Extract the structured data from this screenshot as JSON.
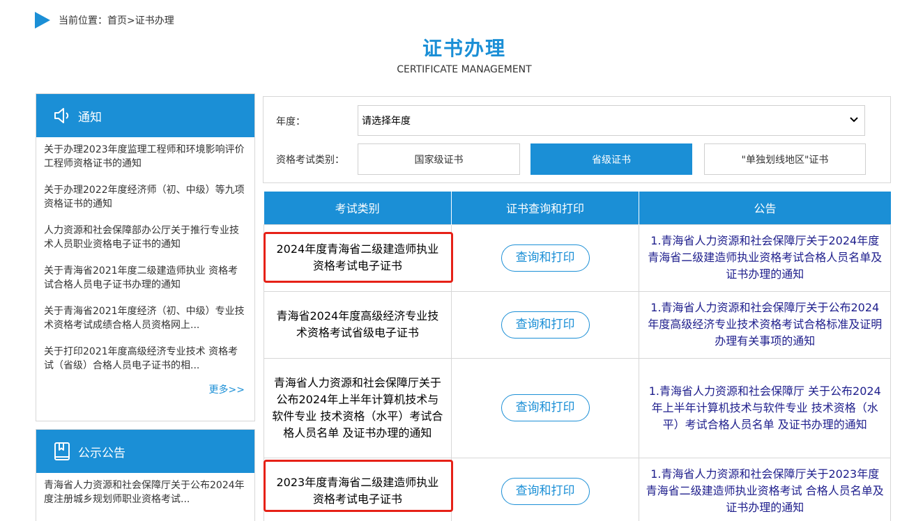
{
  "breadcrumb": {
    "prefix": "当前位置：",
    "home": "首页",
    "sep": ">",
    "current": "证书办理"
  },
  "header": {
    "title": "证书办理",
    "subtitle": "CERTIFICATE MANAGEMENT"
  },
  "sidebar": {
    "notice": {
      "title": "通知",
      "icon": "speaker-icon",
      "items": [
        "关于办理2023年度监理工程师和环境影响评价工程师资格证书的通知",
        "关于办理2022年度经济师（初、中级）等九项资格证书的通知",
        "人力资源和社会保障部办公厅关于推行专业技术人员职业资格电子证书的通知",
        "关于青海省2021年度二级建造师执业 资格考试合格人员电子证书办理的通知",
        "关于青海省2021年度经济（初、中级）专业技术资格考试成绩合格人员资格网上...",
        "关于打印2021年度高级经济专业技术 资格考试（省级）合格人员电子证书的相..."
      ],
      "more": "更多>>"
    },
    "announce": {
      "title": "公示公告",
      "icon": "bookmark-book-icon",
      "items": [
        "青海省人力资源和社会保障厅关于公布2024年度注册城乡规划师职业资格考试..."
      ]
    }
  },
  "filter": {
    "year_label": "年度：",
    "year_value": "请选择年度",
    "type_label": "资格考试类别：",
    "types": [
      "国家级证书",
      "省级证书",
      "\"单独划线地区\"证书"
    ],
    "active_type": "省级证书"
  },
  "table": {
    "headers": [
      "考试类别",
      "证书查询和打印",
      "公告"
    ],
    "rows": [
      {
        "category": "2024年度青海省二级建造师执业资格考试电子证书",
        "action": "查询和打印",
        "notice": "1.青海省人力资源和社会保障厅关于2024年度青海省二级建造师执业资格考试合格人员名单及证书办理的通知",
        "highlighted": true
      },
      {
        "category": "青海省2024年度高级经济专业技术资格考试省级电子证书",
        "action": "查询和打印",
        "notice": "1.青海省人力资源和社会保障厅关于公布2024年度高级经济专业技术资格考试合格标准及证明办理有关事项的通知",
        "highlighted": false
      },
      {
        "category": "青海省人力资源和社会保障厅关于公布2024年上半年计算机技术与软件专业 技术资格（水平）考试合格人员名单 及证书办理的通知",
        "action": "查询和打印",
        "notice": "1.青海省人力资源和社会保障厅 关于公布2024年上半年计算机技术与软件专业 技术资格（水平）考试合格人员名单 及证书办理的通知",
        "highlighted": false
      },
      {
        "category": "2023年度青海省二级建造师执业资格考试电子证书",
        "action": "查询和打印",
        "notice": "1.青海省人力资源和社会保障厅关于2023年度青海省二级建造师执业资格考试 合格人员名单及证书办理的通知",
        "highlighted": true
      }
    ]
  },
  "colors": {
    "primary": "#1b8fd6",
    "highlight": "#e62117",
    "notice_link": "#1e1e8c"
  }
}
